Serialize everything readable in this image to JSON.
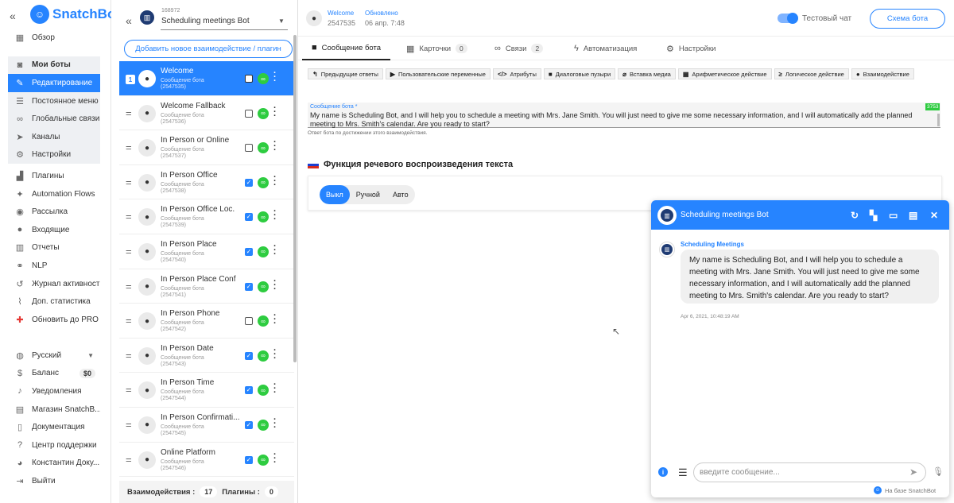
{
  "nav": {
    "brand": "SnatchBot",
    "collapse": "«",
    "items": [
      {
        "label": "Обзор",
        "icon": "grid-icon"
      },
      {
        "label": "Мои боты",
        "icon": "robot-icon"
      },
      {
        "label": "Редактирование",
        "icon": "edit-icon"
      },
      {
        "label": "Постоянное меню",
        "icon": "menu-icon"
      },
      {
        "label": "Глобальные связи",
        "icon": "link-icon"
      },
      {
        "label": "Каналы",
        "icon": "send-icon"
      },
      {
        "label": "Настройки",
        "icon": "gear-icon"
      },
      {
        "label": "Плагины",
        "icon": "plugin-icon"
      },
      {
        "label": "Automation Flows",
        "icon": "flow-icon"
      },
      {
        "label": "Рассылка",
        "icon": "broadcast-icon"
      },
      {
        "label": "Входящие",
        "icon": "inbox-icon"
      },
      {
        "label": "Отчеты",
        "icon": "chart-icon"
      },
      {
        "label": "NLP",
        "icon": "nlp-icon"
      },
      {
        "label": "Журнал активности",
        "icon": "history-icon"
      },
      {
        "label": "Доп. статистика",
        "icon": "stats-icon"
      },
      {
        "label": "Обновить до PRO",
        "icon": "plus-icon"
      }
    ],
    "bottom": [
      {
        "label": "Русский",
        "icon": "globe-icon"
      },
      {
        "label": "Баланс",
        "icon": "dollar-icon",
        "badge": "$0"
      },
      {
        "label": "Уведомления",
        "icon": "bell-icon"
      },
      {
        "label": "Магазин SnatchB...",
        "icon": "store-icon"
      },
      {
        "label": "Документация",
        "icon": "document-icon"
      },
      {
        "label": "Центр поддержки",
        "icon": "support-icon"
      },
      {
        "label": "Константин Доку...",
        "icon": "user-icon"
      },
      {
        "label": "Выйти",
        "icon": "logout-icon"
      }
    ]
  },
  "botlist": {
    "back": "«",
    "bot_id": "168972",
    "bot_name": "Scheduling meetings Bot",
    "add_button": "Добавить новое взаимодействие / плагин",
    "items": [
      {
        "name": "Welcome",
        "type": "Сообщение бота",
        "id": "(2547535)",
        "checked": false,
        "selected": true,
        "num": "1"
      },
      {
        "name": "Welcome Fallback",
        "type": "Сообщение бота",
        "id": "(2547536)",
        "checked": false
      },
      {
        "name": "In Person or Online",
        "type": "Сообщение бота",
        "id": "(2547537)",
        "checked": false
      },
      {
        "name": "In Person Office",
        "type": "Сообщение бота",
        "id": "(2547538)",
        "checked": true
      },
      {
        "name": "In Person Office Loc.",
        "type": "Сообщение бота",
        "id": "(2547539)",
        "checked": true
      },
      {
        "name": "In Person Place",
        "type": "Сообщение бота",
        "id": "(2547540)",
        "checked": true
      },
      {
        "name": "In Person Place Conf",
        "type": "Сообщение бота",
        "id": "(2547541)",
        "checked": true
      },
      {
        "name": "In Person Phone",
        "type": "Сообщение бота",
        "id": "(2547542)",
        "checked": false
      },
      {
        "name": "In Person Date",
        "type": "Сообщение бота",
        "id": "(2547543)",
        "checked": true
      },
      {
        "name": "In Person Time",
        "type": "Сообщение бота",
        "id": "(2547544)",
        "checked": true
      },
      {
        "name": "In Person Confirmati...",
        "type": "Сообщение бота",
        "id": "(2547545)",
        "checked": true
      },
      {
        "name": "Online Platform",
        "type": "Сообщение бота",
        "id": "(2547546)",
        "checked": true
      }
    ],
    "footer": {
      "interactions_label": "Взаимодействия :",
      "interactions_count": "17",
      "plugins_label": "Плагины :",
      "plugins_count": "0"
    }
  },
  "header": {
    "name_label": "Welcome",
    "id": "2547535",
    "updated_label": "Обновлено",
    "updated_date": "06 апр. 7:48",
    "test_chat": "Тестовый чат",
    "schema_button": "Схема бота"
  },
  "tabs": [
    {
      "label": "Сообщение бота",
      "icon": "message-icon"
    },
    {
      "label": "Карточки",
      "count": "0",
      "icon": "cards-icon"
    },
    {
      "label": "Связи",
      "count": "2",
      "icon": "link-icon"
    },
    {
      "label": "Автоматизация",
      "icon": "bolt-icon"
    },
    {
      "label": "Настройки",
      "icon": "gear-icon"
    }
  ],
  "toolbar": [
    {
      "label": "Предыдущие ответы",
      "icon": "reply-icon"
    },
    {
      "label": "Пользовательские переменные",
      "icon": "play-icon"
    },
    {
      "label": "Атрибуты",
      "icon": "code-icon"
    },
    {
      "label": "Диалоговые пузыри",
      "icon": "bubble-icon"
    },
    {
      "label": "Вставка медиа",
      "icon": "attach-icon"
    },
    {
      "label": "Арифметическое действие",
      "icon": "calculator-icon"
    },
    {
      "label": "Логическое действие",
      "icon": "logic-icon"
    },
    {
      "label": "Взаимодействие",
      "icon": "bubble-icon"
    }
  ],
  "message": {
    "label": "Сообщение бота *",
    "text": "My name is Scheduling Bot, and I will help you to schedule a meeting with Mrs. Jane Smith. You will just need to give me some necessary information, and I will automatically add the planned meeting to Mrs. Smith's calendar. Are you ready to start?",
    "counter": "3753",
    "help": "Ответ бота по достижении этого взаимодействия."
  },
  "tts": {
    "title": "Функция речевого воспроизведения текста",
    "options": [
      "Выкл",
      "Ручной",
      "Авто"
    ],
    "selected": "Выкл"
  },
  "chat": {
    "title": "Scheduling meetings Bot",
    "sender": "Scheduling Meetings",
    "message": "My name is Scheduling Bot, and I will help you to schedule a meeting with Mrs. Jane Smith. You will just need to give me some necessary information, and I will automatically add the planned meeting to Mrs. Smith's calendar. Are you ready to start?",
    "timestamp": "Apr 6, 2021, 10:48:19 AM",
    "input_placeholder": "введите сообщение...",
    "powered_by": "На базе SnatchBot"
  },
  "colors": {
    "accent": "#2684ff",
    "link_green": "#2ecc40",
    "bot_avatar": "#1f3b73"
  }
}
